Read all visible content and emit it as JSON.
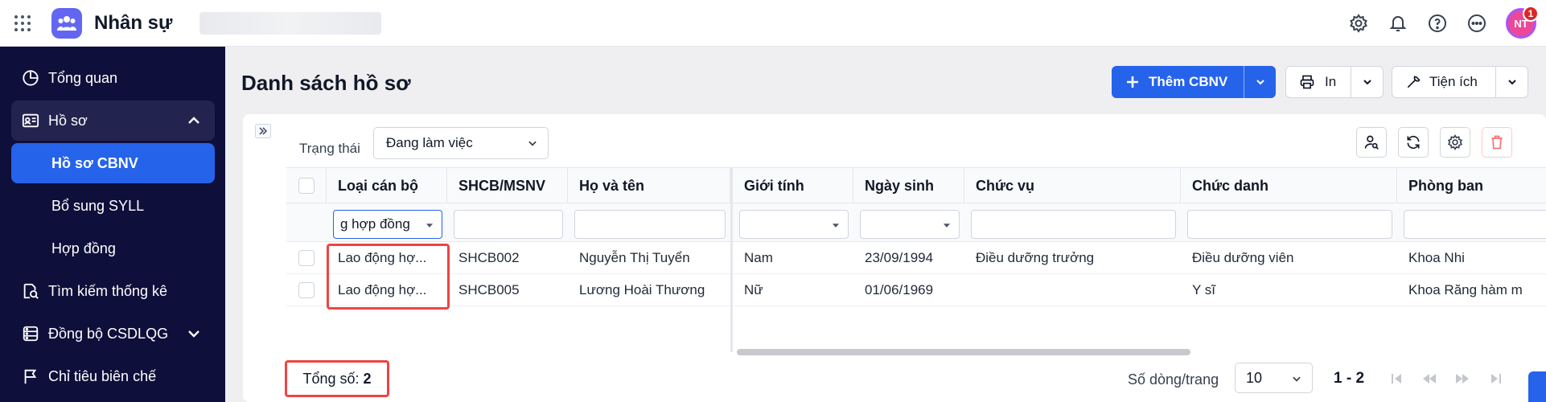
{
  "app": {
    "name": "Nhân sự"
  },
  "user": {
    "initials": "NT",
    "notification_count": "1"
  },
  "sidebar": {
    "items": [
      {
        "label": "Tổng quan"
      },
      {
        "label": "Hồ sơ"
      },
      {
        "label": "Hồ sơ CBNV"
      },
      {
        "label": "Bổ sung SYLL"
      },
      {
        "label": "Hợp đồng"
      },
      {
        "label": "Tìm kiếm thống kê"
      },
      {
        "label": "Đồng bộ CSDLQG"
      },
      {
        "label": "Chỉ tiêu biên chế"
      }
    ]
  },
  "page": {
    "title": "Danh sách hồ sơ"
  },
  "toolbar": {
    "add_label": "Thêm CBNV",
    "print_label": "In",
    "utilities_label": "Tiện ích"
  },
  "filter": {
    "status_label": "Trạng thái",
    "status_value": "Đang làm việc"
  },
  "table": {
    "columns": [
      "Loại cán bộ",
      "SHCB/MSNV",
      "Họ và tên",
      "Giới tính",
      "Ngày sinh",
      "Chức vụ",
      "Chức danh",
      "Phòng ban"
    ],
    "filter_values": {
      "loai_can_bo": "g hợp đồng"
    },
    "rows": [
      {
        "loai_can_bo": "Lao động hợ...",
        "shcb": "SHCB002",
        "ho_ten": "Nguyễn Thị Tuyển",
        "gioi_tinh": "Nam",
        "ngay_sinh": "23/09/1994",
        "chuc_vu": "Điều dưỡng trưởng",
        "chuc_danh": "Điều dưỡng viên",
        "phong_ban": "Khoa Nhi"
      },
      {
        "loai_can_bo": "Lao động hợ...",
        "shcb": "SHCB005",
        "ho_ten": "Lương Hoài Thương",
        "gioi_tinh": "Nữ",
        "ngay_sinh": "01/06/1969",
        "chuc_vu": "",
        "chuc_danh": "Y sĩ",
        "phong_ban": "Khoa Răng hàm m"
      }
    ]
  },
  "footer": {
    "total_label": "Tổng số:",
    "total_value": "2",
    "rows_per_page_label": "Số dòng/trang",
    "rows_per_page_value": "10",
    "range": "1 - 2"
  },
  "colors": {
    "primary": "#2563eb",
    "sidebar_bg": "#0f0f3b",
    "highlight": "#ef4444"
  }
}
